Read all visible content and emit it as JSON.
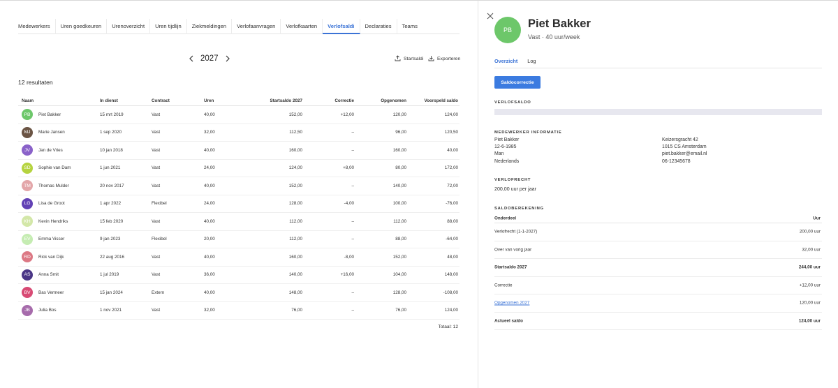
{
  "tabs": [
    "Medewerkers",
    "Uren goedkeuren",
    "Urenoverzicht",
    "Uren tijdlijn",
    "Ziekmeldingen",
    "Verlofaanvragen",
    "Verlofkaarten",
    "Verlofsaldi",
    "Declaraties",
    "Teams"
  ],
  "active_tab": "Verlofsaldi",
  "year": "2027",
  "actions": {
    "startsaldi": "Startsaldi",
    "exporteren": "Exporteren"
  },
  "result_count": "12 resultaten",
  "table": {
    "headers": [
      "Naam",
      "In dienst",
      "Contract",
      "Uren",
      "Startsaldo 2027",
      "Correctie",
      "Opgenomen",
      "Voorspeld saldo"
    ],
    "rows": [
      {
        "initials": "PB",
        "color": "#6dc76a",
        "name": "Piet Bakker",
        "indienst": "15 mrt 2019",
        "contract": "Vast",
        "uren": "40,00",
        "start": "152,00",
        "corr": "+12,00",
        "opg": "120,00",
        "voor": "124,00"
      },
      {
        "initials": "MJ",
        "color": "#6b5444",
        "name": "Marie Jansen",
        "indienst": "1 sep 2020",
        "contract": "Vast",
        "uren": "32,00",
        "start": "112,50",
        "corr": "–",
        "opg": "96,00",
        "voor": "120,50"
      },
      {
        "initials": "JV",
        "color": "#8a62c9",
        "name": "Jan de Vries",
        "indienst": "10 jan 2018",
        "contract": "Vast",
        "uren": "40,00",
        "start": "160,00",
        "corr": "–",
        "opg": "160,00",
        "voor": "40,00"
      },
      {
        "initials": "SD",
        "color": "#b5d33f",
        "name": "Sophie van Dam",
        "indienst": "1 jun 2021",
        "contract": "Vast",
        "uren": "24,00",
        "start": "124,00",
        "corr": "+8,00",
        "opg": "80,00",
        "voor": "172,00"
      },
      {
        "initials": "TM",
        "color": "#e3a6a9",
        "name": "Thomas Mulder",
        "indienst": "20 nov 2017",
        "contract": "Vast",
        "uren": "40,00",
        "start": "152,00",
        "corr": "–",
        "opg": "140,00",
        "voor": "72,00"
      },
      {
        "initials": "LG",
        "color": "#6241b5",
        "name": "Lisa de Groot",
        "indienst": "1 apr 2022",
        "contract": "Flexibel",
        "uren": "24,00",
        "start": "128,00",
        "corr": "-4,00",
        "opg": "100,00",
        "voor": "-76,00"
      },
      {
        "initials": "KH",
        "color": "#d3e7a8",
        "name": "Kevin Hendriks",
        "indienst": "15 feb 2020",
        "contract": "Vast",
        "uren": "40,00",
        "start": "112,00",
        "corr": "–",
        "opg": "112,00",
        "voor": "88,00"
      },
      {
        "initials": "EV",
        "color": "#c5ecb2",
        "name": "Emma Visser",
        "indienst": "9 jan 2023",
        "contract": "Flexibel",
        "uren": "20,00",
        "start": "112,00",
        "corr": "–",
        "opg": "88,00",
        "voor": "-64,00"
      },
      {
        "initials": "RD",
        "color": "#dc7884",
        "name": "Rick van Dijk",
        "indienst": "22 aug 2016",
        "contract": "Vast",
        "uren": "40,00",
        "start": "160,00",
        "corr": "-8,00",
        "opg": "152,00",
        "voor": "48,00"
      },
      {
        "initials": "AS",
        "color": "#4a3686",
        "name": "Anna Smit",
        "indienst": "1 jul 2019",
        "contract": "Vast",
        "uren": "36,00",
        "start": "140,00",
        "corr": "+16,00",
        "opg": "104,00",
        "voor": "148,00"
      },
      {
        "initials": "BV",
        "color": "#d84a74",
        "name": "Bas Vermeer",
        "indienst": "15 jan 2024",
        "contract": "Extern",
        "uren": "40,00",
        "start": "148,00",
        "corr": "–",
        "opg": "128,00",
        "voor": "-108,00"
      },
      {
        "initials": "JB",
        "color": "#a66bab",
        "name": "Julia Bos",
        "indienst": "1 nov 2021",
        "contract": "Vast",
        "uren": "32,00",
        "start": "76,00",
        "corr": "–",
        "opg": "76,00",
        "voor": "124,00"
      }
    ],
    "total": "Totaal: 12"
  },
  "detail": {
    "initials": "PB",
    "name": "Piet Bakker",
    "subtitle": "Vast · 40 uur/week",
    "tabs": [
      "Overzicht",
      "Log"
    ],
    "button": "Saldocorrectie",
    "section_verlofsaldo": "VERLOFSALDO",
    "section_info": "MEDEWERKER INFORMATIE",
    "info_left": [
      "Piet Bakker",
      "12-6-1985",
      "Man",
      "Nederlands"
    ],
    "info_right": [
      "Keizersgracht 42",
      "1015 CS Amsterdam",
      "piet.bakker@email.nl",
      "06-12345678"
    ],
    "section_recht": "VERLOFRECHT",
    "recht_value": "200,00 uur per jaar",
    "section_saldo": "SALDOBEREKENING",
    "saldo_headers": [
      "Onderdeel",
      "Uur"
    ],
    "saldo_rows": [
      {
        "label": "Verlofrecht (1-1-2027)",
        "value": "200,00 uur"
      },
      {
        "label": "Over van vorig jaar",
        "value": "32,00 uur"
      },
      {
        "label": "Startsaldo 2027",
        "value": "244,00 uur"
      },
      {
        "label": "Correctie",
        "value": "+12,00 uur"
      },
      {
        "label": "Opgenomen 2027",
        "value": "120,00 uur"
      },
      {
        "label": "Actueel saldo",
        "value": "124,00 uur"
      }
    ]
  }
}
